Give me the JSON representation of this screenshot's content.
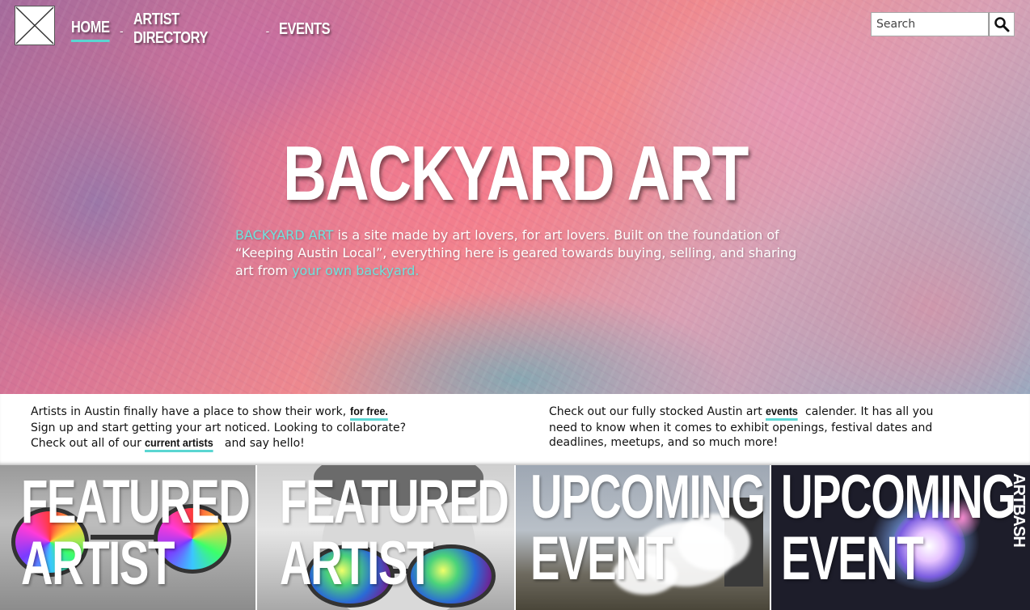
{
  "nav": {
    "items": [
      {
        "label": "HOME",
        "active": true
      },
      {
        "label": "ARTIST DIRECTORY",
        "active": false
      },
      {
        "label": "EVENTS",
        "active": false
      }
    ],
    "separator": "-"
  },
  "search": {
    "placeholder": "Search",
    "icon": "search-icon"
  },
  "hero": {
    "title": "BACKYARD ART",
    "desc_brand": "BACKYARD ART",
    "desc_middle": " is a site made by art lovers, for art lovers. Built on the foundation of “Keeping Austin Local”, everything here is geared towards buying, selling, and sharing art from ",
    "desc_link": "your own backyard."
  },
  "info": {
    "left": {
      "line1_text": "Artists in Austin finally have a place to show their work, ",
      "line1_link": "for free.",
      "line2_text": "Sign up and start getting your art noticed. Looking to collaborate?",
      "line3_pre": "Check out all of our ",
      "line3_link": "current artists",
      "line3_post": " and say hello!"
    },
    "right": {
      "pre": "Check out our fully stocked Austin art ",
      "link": "events",
      "post": " calender. It has all you need to know when it comes to exhibit openings, festival dates and deadlines, meetups, and so much more!"
    }
  },
  "tiles": [
    {
      "line1": "FEATURED",
      "line2": "ARTIST"
    },
    {
      "line1": "FEATURED",
      "line2": "ARTIST"
    },
    {
      "line1": "UPCOMING",
      "line2": "EVENT"
    },
    {
      "line1": "UPCOMING",
      "line2": "EVENT",
      "tag": "ARTBASH"
    }
  ],
  "colors": {
    "accent": "#5ad6d2",
    "hero_link": "#6fe2de"
  }
}
